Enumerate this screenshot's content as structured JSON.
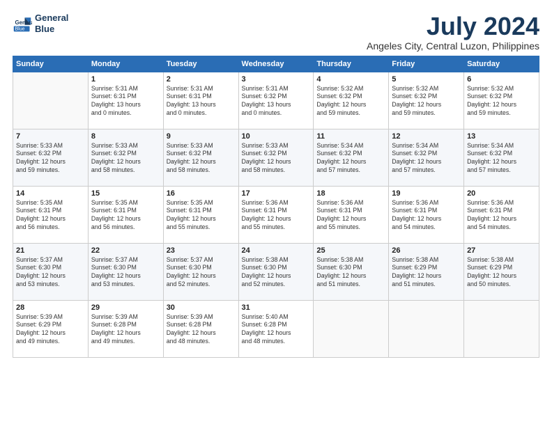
{
  "logo": {
    "line1": "General",
    "line2": "Blue"
  },
  "title": "July 2024",
  "subtitle": "Angeles City, Central Luzon, Philippines",
  "weekdays": [
    "Sunday",
    "Monday",
    "Tuesday",
    "Wednesday",
    "Thursday",
    "Friday",
    "Saturday"
  ],
  "weeks": [
    [
      {
        "day": "",
        "info": ""
      },
      {
        "day": "1",
        "info": "Sunrise: 5:31 AM\nSunset: 6:31 PM\nDaylight: 13 hours\nand 0 minutes."
      },
      {
        "day": "2",
        "info": "Sunrise: 5:31 AM\nSunset: 6:31 PM\nDaylight: 13 hours\nand 0 minutes."
      },
      {
        "day": "3",
        "info": "Sunrise: 5:31 AM\nSunset: 6:32 PM\nDaylight: 13 hours\nand 0 minutes."
      },
      {
        "day": "4",
        "info": "Sunrise: 5:32 AM\nSunset: 6:32 PM\nDaylight: 12 hours\nand 59 minutes."
      },
      {
        "day": "5",
        "info": "Sunrise: 5:32 AM\nSunset: 6:32 PM\nDaylight: 12 hours\nand 59 minutes."
      },
      {
        "day": "6",
        "info": "Sunrise: 5:32 AM\nSunset: 6:32 PM\nDaylight: 12 hours\nand 59 minutes."
      }
    ],
    [
      {
        "day": "7",
        "info": "Sunrise: 5:33 AM\nSunset: 6:32 PM\nDaylight: 12 hours\nand 59 minutes."
      },
      {
        "day": "8",
        "info": "Sunrise: 5:33 AM\nSunset: 6:32 PM\nDaylight: 12 hours\nand 58 minutes."
      },
      {
        "day": "9",
        "info": "Sunrise: 5:33 AM\nSunset: 6:32 PM\nDaylight: 12 hours\nand 58 minutes."
      },
      {
        "day": "10",
        "info": "Sunrise: 5:33 AM\nSunset: 6:32 PM\nDaylight: 12 hours\nand 58 minutes."
      },
      {
        "day": "11",
        "info": "Sunrise: 5:34 AM\nSunset: 6:32 PM\nDaylight: 12 hours\nand 57 minutes."
      },
      {
        "day": "12",
        "info": "Sunrise: 5:34 AM\nSunset: 6:32 PM\nDaylight: 12 hours\nand 57 minutes."
      },
      {
        "day": "13",
        "info": "Sunrise: 5:34 AM\nSunset: 6:32 PM\nDaylight: 12 hours\nand 57 minutes."
      }
    ],
    [
      {
        "day": "14",
        "info": "Sunrise: 5:35 AM\nSunset: 6:31 PM\nDaylight: 12 hours\nand 56 minutes."
      },
      {
        "day": "15",
        "info": "Sunrise: 5:35 AM\nSunset: 6:31 PM\nDaylight: 12 hours\nand 56 minutes."
      },
      {
        "day": "16",
        "info": "Sunrise: 5:35 AM\nSunset: 6:31 PM\nDaylight: 12 hours\nand 55 minutes."
      },
      {
        "day": "17",
        "info": "Sunrise: 5:36 AM\nSunset: 6:31 PM\nDaylight: 12 hours\nand 55 minutes."
      },
      {
        "day": "18",
        "info": "Sunrise: 5:36 AM\nSunset: 6:31 PM\nDaylight: 12 hours\nand 55 minutes."
      },
      {
        "day": "19",
        "info": "Sunrise: 5:36 AM\nSunset: 6:31 PM\nDaylight: 12 hours\nand 54 minutes."
      },
      {
        "day": "20",
        "info": "Sunrise: 5:36 AM\nSunset: 6:31 PM\nDaylight: 12 hours\nand 54 minutes."
      }
    ],
    [
      {
        "day": "21",
        "info": "Sunrise: 5:37 AM\nSunset: 6:30 PM\nDaylight: 12 hours\nand 53 minutes."
      },
      {
        "day": "22",
        "info": "Sunrise: 5:37 AM\nSunset: 6:30 PM\nDaylight: 12 hours\nand 53 minutes."
      },
      {
        "day": "23",
        "info": "Sunrise: 5:37 AM\nSunset: 6:30 PM\nDaylight: 12 hours\nand 52 minutes."
      },
      {
        "day": "24",
        "info": "Sunrise: 5:38 AM\nSunset: 6:30 PM\nDaylight: 12 hours\nand 52 minutes."
      },
      {
        "day": "25",
        "info": "Sunrise: 5:38 AM\nSunset: 6:30 PM\nDaylight: 12 hours\nand 51 minutes."
      },
      {
        "day": "26",
        "info": "Sunrise: 5:38 AM\nSunset: 6:29 PM\nDaylight: 12 hours\nand 51 minutes."
      },
      {
        "day": "27",
        "info": "Sunrise: 5:38 AM\nSunset: 6:29 PM\nDaylight: 12 hours\nand 50 minutes."
      }
    ],
    [
      {
        "day": "28",
        "info": "Sunrise: 5:39 AM\nSunset: 6:29 PM\nDaylight: 12 hours\nand 49 minutes."
      },
      {
        "day": "29",
        "info": "Sunrise: 5:39 AM\nSunset: 6:28 PM\nDaylight: 12 hours\nand 49 minutes."
      },
      {
        "day": "30",
        "info": "Sunrise: 5:39 AM\nSunset: 6:28 PM\nDaylight: 12 hours\nand 48 minutes."
      },
      {
        "day": "31",
        "info": "Sunrise: 5:40 AM\nSunset: 6:28 PM\nDaylight: 12 hours\nand 48 minutes."
      },
      {
        "day": "",
        "info": ""
      },
      {
        "day": "",
        "info": ""
      },
      {
        "day": "",
        "info": ""
      }
    ]
  ]
}
